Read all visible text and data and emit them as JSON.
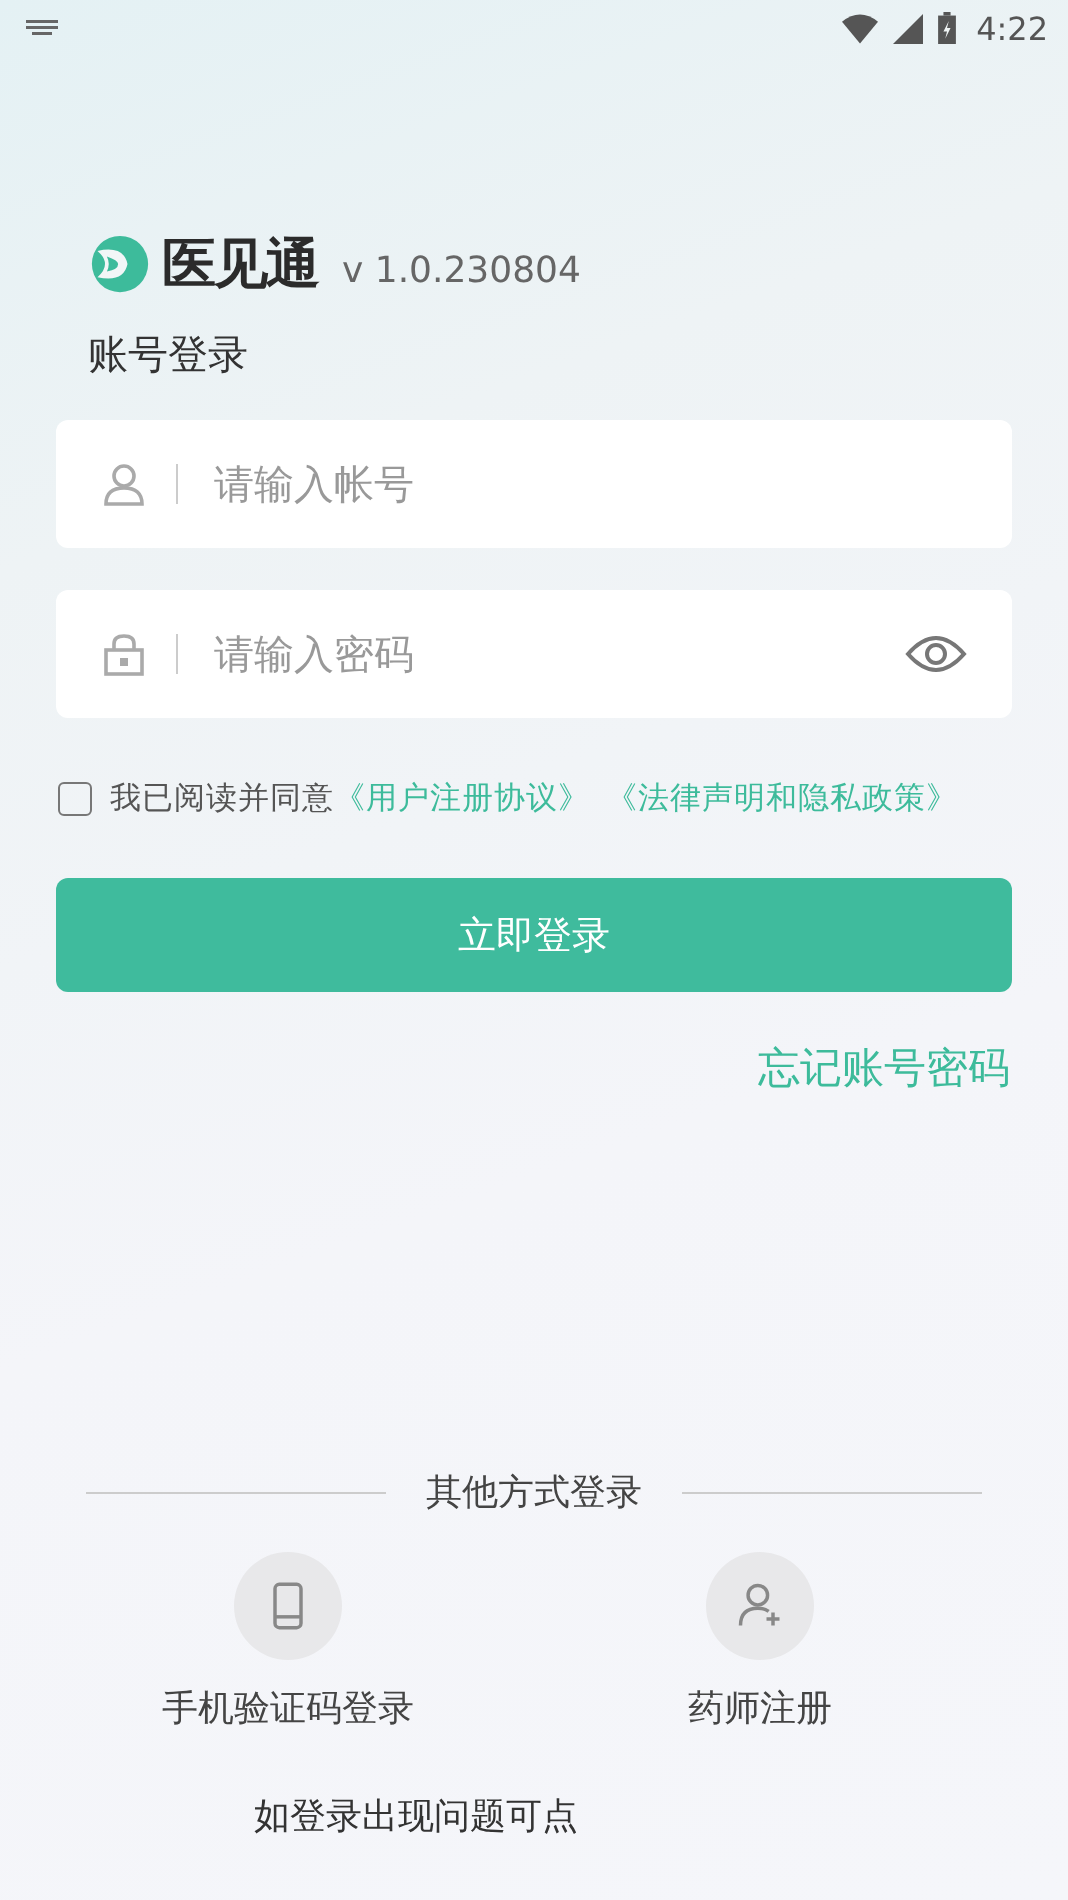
{
  "status_bar": {
    "time": "4:22"
  },
  "app": {
    "name": "医见通",
    "version": "v 1.0.230804"
  },
  "login_title": "账号登录",
  "fields": [
    {
      "kind": "account",
      "placeholder": "请输入帐号"
    },
    {
      "kind": "password",
      "placeholder": "请输入密码"
    }
  ],
  "agreement": {
    "checked": false,
    "text": "我已阅读并同意",
    "links": [
      "《用户注册协议》",
      "《法律声明和隐私政策》"
    ]
  },
  "login_button": "立即登录",
  "forgot_link": "忘记账号密码",
  "other_login": {
    "title": "其他方式登录",
    "options": [
      {
        "kind": "phone",
        "label": "手机验证码登录"
      },
      {
        "kind": "register",
        "label": "药师注册"
      }
    ]
  },
  "help_text": "如登录出现问题可点"
}
